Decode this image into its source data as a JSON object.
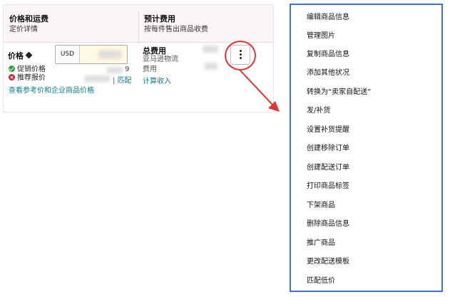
{
  "table": {
    "header": {
      "col1_title": "价格和运费",
      "col1_sub": "定价详情",
      "col2_title": "预计费用",
      "col2_sub": "按每件售出商品收费"
    },
    "price_label": "价格",
    "currency": "USD",
    "status_promo": "促销价格",
    "status_promo_tail": "9",
    "status_recommended": "推荐报价",
    "match_link": "匹配",
    "match_sep": "|",
    "reference_link": "查看参考价和企业商品价格",
    "fee_title": "总费用",
    "fee_line1": "亚马逊物流",
    "fee_line2": "费用",
    "fee_link": "计算收入"
  },
  "menu": {
    "items": [
      "编辑商品信息",
      "管理图片",
      "复制商品信息",
      "添加其他状况",
      "转换为“卖家自配送”",
      "发/补货",
      "设置补货提醒",
      "创建移除订单",
      "创建配送订单",
      "打印商品标签",
      "下架商品",
      "删除商品信息",
      "推广商品",
      "更改配送模板",
      "匹配低价"
    ]
  },
  "colors": {
    "accent_link": "#0a7d8c",
    "highlight": "#e23434",
    "menu_border": "#3b73c8",
    "header_bg": "#fbf5f8"
  },
  "icons": [
    "tag-icon",
    "check-circle-icon",
    "x-circle-icon",
    "kebab-icon"
  ]
}
